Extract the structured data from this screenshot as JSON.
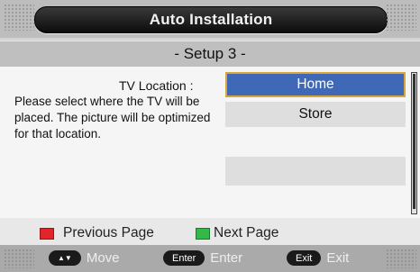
{
  "header": {
    "title": "Auto Installation"
  },
  "subheader": {
    "text": "- Setup 3 -"
  },
  "content": {
    "location_label": "TV Location :",
    "description": "Please select where the TV will be placed. The picture will be optimized for that location.",
    "options": [
      {
        "label": "Home",
        "selected": true
      },
      {
        "label": "Store",
        "selected": false
      },
      {
        "label": "",
        "selected": false
      }
    ]
  },
  "color_keys": [
    {
      "color": "#e0262b",
      "label": "Previous Page"
    },
    {
      "color": "#33b84a",
      "label": "Next Page"
    }
  ],
  "footer": {
    "move": {
      "key_icon": "up-down-arrows-icon",
      "label": "Move"
    },
    "enter": {
      "key_label": "Enter",
      "label": "Enter"
    },
    "exit": {
      "key_label": "Exit",
      "label": "Exit"
    }
  },
  "colors": {
    "selected_option": "#3f69b7",
    "selected_border": "#d8a43c",
    "title_bar": "#1a1a1a"
  }
}
